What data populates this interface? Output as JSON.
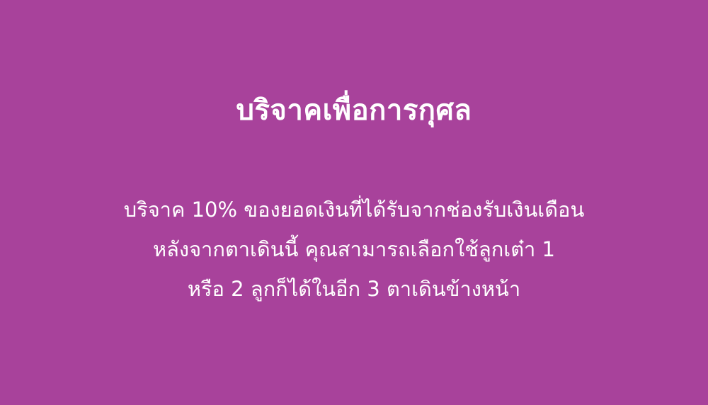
{
  "card": {
    "background_color": "#a8429b",
    "text_color": "#ffffff",
    "title": "บริจาคเพื่อการกุศล",
    "description_lines": [
      "บริจาค 10% ของยอดเงินที่ได้รับจากช่องรับเงินเดือน",
      "หลังจากตาเดินนี้ คุณสามารถเลือกใช้ลูกเต๋า 1",
      "หรือ 2 ลูกก็ได้ในอีก 3 ตาเดินข้างหน้า"
    ]
  }
}
